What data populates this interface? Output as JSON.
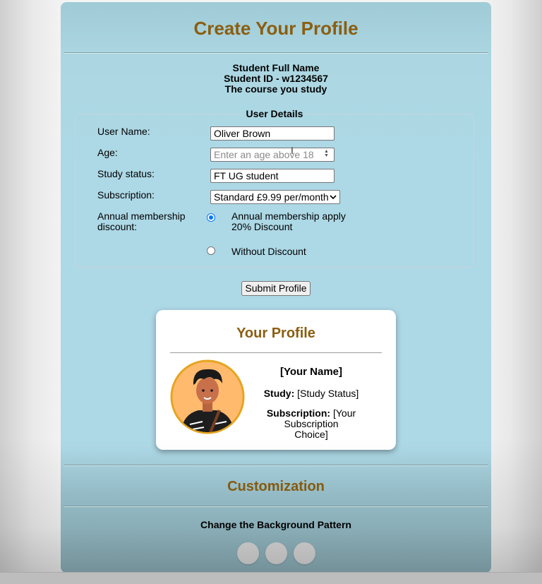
{
  "page": {
    "title": "Create Your Profile",
    "student": {
      "name": "Student Full Name",
      "id": "Student ID - w1234567",
      "course": "The course you study"
    }
  },
  "form": {
    "legend": "User Details",
    "username": {
      "label": "User Name:",
      "value": "Oliver Brown"
    },
    "age": {
      "label": "Age:",
      "placeholder": "Enter an age above 18"
    },
    "study_status": {
      "label": "Study status:",
      "value": "FT UG student"
    },
    "subscription": {
      "label": "Subscription:",
      "selected": "Standard £9.99 per/month"
    },
    "discount": {
      "label_line1": "Annual membership",
      "label_line2": "discount:",
      "options": [
        {
          "line1": "Annual membership apply",
          "line2": "20% Discount",
          "checked": true
        },
        {
          "line1": "Without Discount",
          "checked": false
        }
      ]
    },
    "submit_label": "Submit Profile"
  },
  "profile": {
    "title": "Your Profile",
    "name": "[Your Name]",
    "study_label": "Study:",
    "study_value": "[Study Status]",
    "subscription_label": "Subscription:",
    "subscription_value_line1": "[Your Subscription",
    "subscription_value_line2": "Choice]"
  },
  "customization": {
    "title": "Customization",
    "pattern_label": "Change the Background Pattern",
    "pattern_buttons": 3
  },
  "colors": {
    "accent": "#8b5e10",
    "card_bg": "#add8e6",
    "radio_checked": "#0075ff"
  }
}
